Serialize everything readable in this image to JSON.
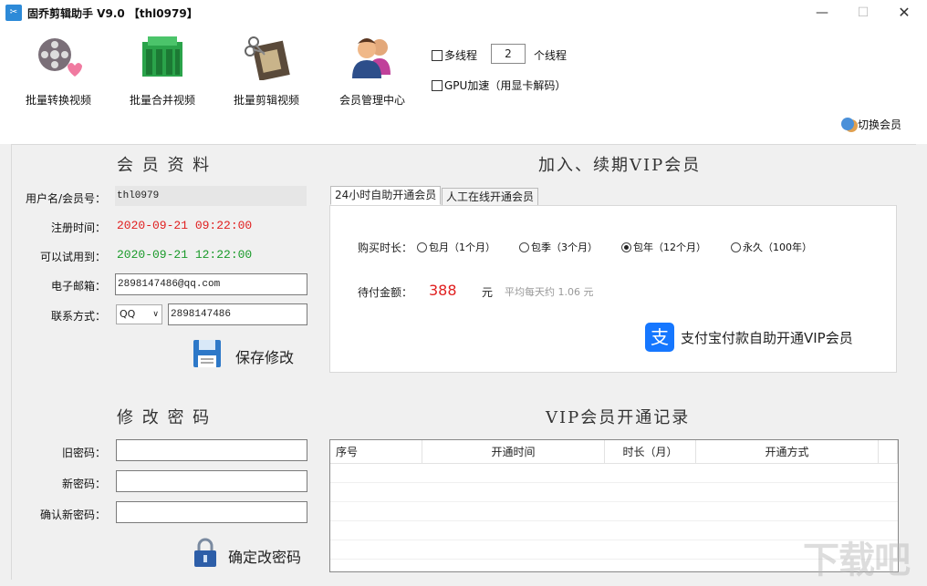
{
  "window": {
    "title": "固乔剪辑助手 V9.0 【thl0979】"
  },
  "toolbar": {
    "tools": [
      {
        "label": "批量转换视频",
        "icon": "film-reel-icon"
      },
      {
        "label": "批量合并视频",
        "icon": "merge-bars-icon"
      },
      {
        "label": "批量剪辑视频",
        "icon": "film-scissors-icon"
      },
      {
        "label": "会员管理中心",
        "icon": "users-icon"
      }
    ],
    "multithread_label": "多线程",
    "multithread_checked": false,
    "thread_count": "2",
    "thread_unit": "个线程",
    "gpu_label": "GPU加速（用显卡解码）",
    "gpu_checked": false,
    "switch_member": "切换会员"
  },
  "member_info": {
    "title": "会 员 资 料",
    "username_label": "用户名/会员号：",
    "username": "thl0979",
    "register_label": "注册时间：",
    "register_time": "2020-09-21 09:22:00",
    "trial_label": "可以试用到：",
    "trial_until": "2020-09-21 12:22:00",
    "email_label": "电子邮箱：",
    "email": "2898147486@qq.com",
    "contact_label": "联系方式：",
    "contact_type": "QQ",
    "contact_value": "2898147486",
    "save_label": "保存修改",
    "colors": {
      "register": "#e02020",
      "trial": "#1a9a2a"
    }
  },
  "password": {
    "title": "修 改 密 码",
    "old_label": "旧密码：",
    "new_label": "新密码：",
    "confirm_label": "确认新密码：",
    "old_value": "",
    "new_value": "",
    "confirm_value": "",
    "submit_label": "确定改密码"
  },
  "vip": {
    "title": "加入、续期VIP会员",
    "tabs": [
      "24小时自助开通会员",
      "人工在线开通会员"
    ],
    "active_tab": 0,
    "duration_label": "购买时长：",
    "options": [
      {
        "label": "包月（1个月）",
        "selected": false
      },
      {
        "label": "包季（3个月）",
        "selected": false
      },
      {
        "label": "包年（12个月）",
        "selected": true
      },
      {
        "label": "永久（100年）",
        "selected": false
      }
    ],
    "amount_label": "待付金额：",
    "amount": "388",
    "currency": "元",
    "avg_note": "平均每天约 1.06 元",
    "alipay_label": "支付宝付款自助开通VIP会员",
    "colors": {
      "amount": "#e02020",
      "alipay": "#1677ff"
    }
  },
  "records": {
    "title": "VIP会员开通记录",
    "columns": [
      "序号",
      "开通时间",
      "时长（月）",
      "开通方式"
    ],
    "rows": []
  },
  "watermark": "下载吧"
}
